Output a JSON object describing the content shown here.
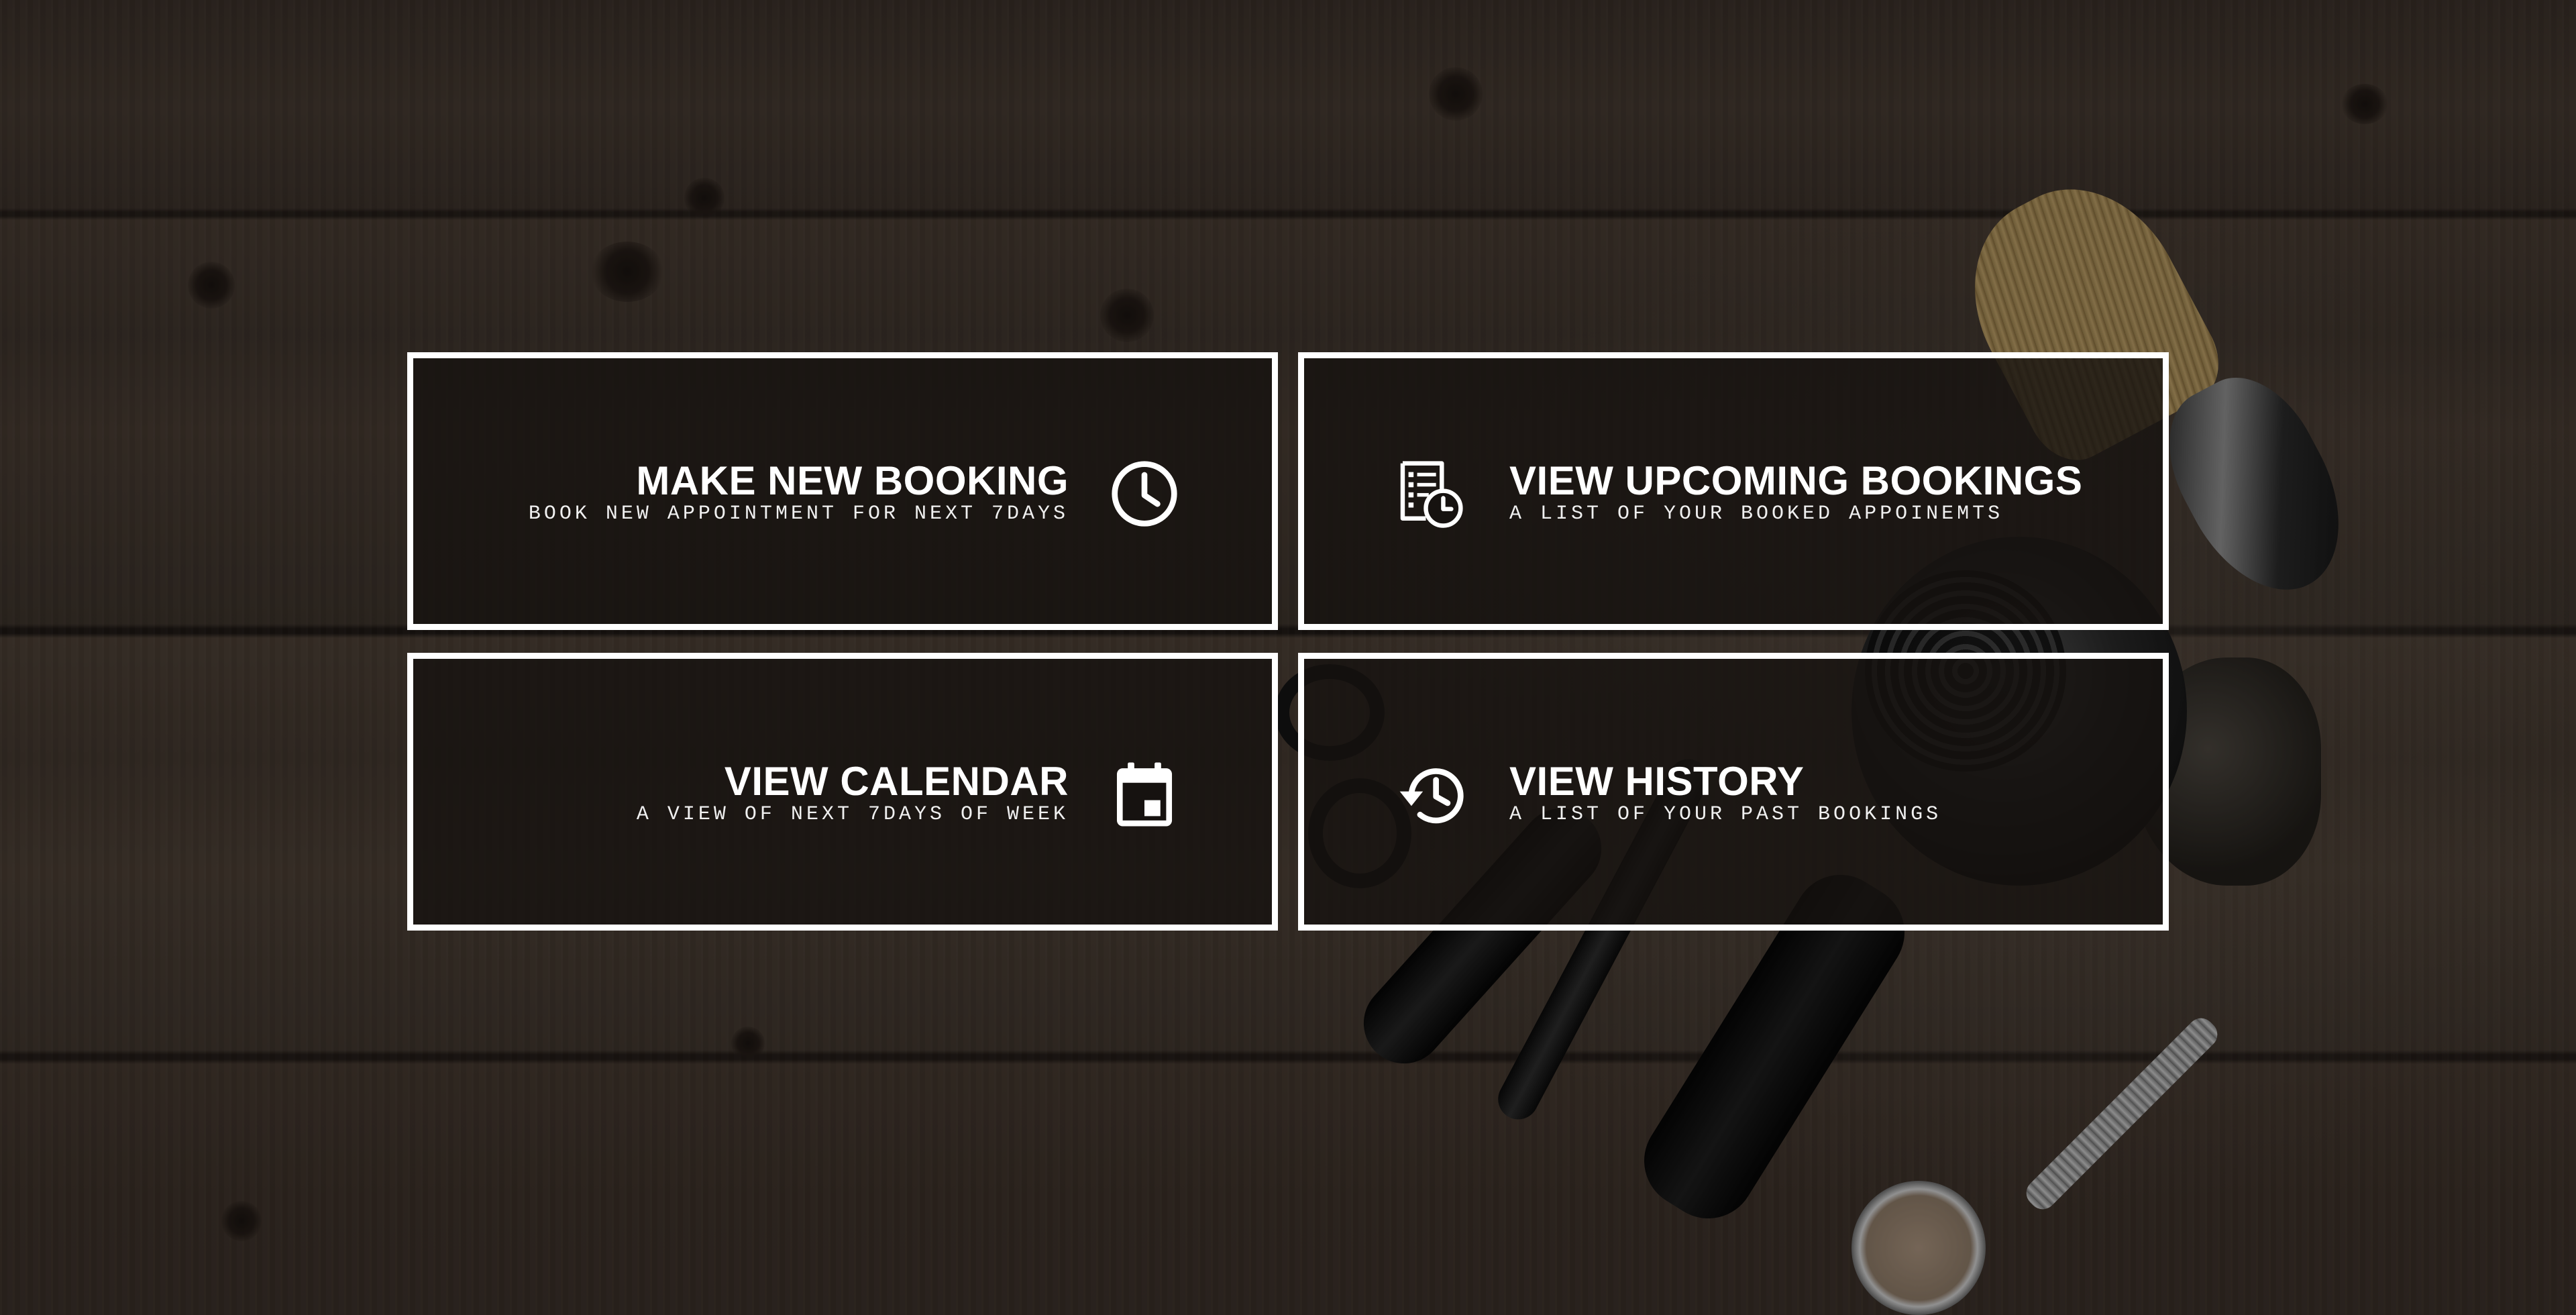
{
  "menu": {
    "tiles": [
      {
        "title": "MAKE NEW BOOKING",
        "subtitle": "BOOK NEW APPOINTMENT FOR NEXT 7DAYS",
        "icon": "clock-icon"
      },
      {
        "title": "VIEW UPCOMING BOOKINGS",
        "subtitle": "A LIST OF YOUR BOOKED APPOINEMTS",
        "icon": "list-clock-icon"
      },
      {
        "title": "VIEW CALENDAR",
        "subtitle": "A VIEW OF NEXT 7DAYS OF WEEK",
        "icon": "calendar-icon"
      },
      {
        "title": "VIEW HISTORY",
        "subtitle": "A LIST OF YOUR PAST BOOKINGS",
        "icon": "history-icon"
      }
    ]
  },
  "colors": {
    "tile_border": "#ffffff",
    "tile_background": "#161210",
    "text": "#ffffff"
  }
}
